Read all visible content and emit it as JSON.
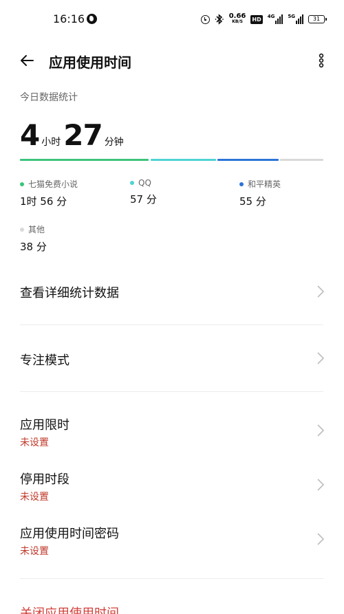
{
  "status_bar": {
    "time": "16:16",
    "speed_value": "0.66",
    "speed_unit": "KB/S",
    "hd_badge": "HD",
    "net1_label": "4G",
    "net2_label": "5G",
    "battery": "31"
  },
  "header": {
    "title": "应用使用时间"
  },
  "stats": {
    "section_label": "今日数据统计",
    "hours": "4",
    "hours_unit": "小时",
    "minutes": "27",
    "minutes_unit": "分钟",
    "bar_colors": [
      "#3cc47c",
      "#4fd3d4",
      "#2b74d8",
      "#d9d9d9"
    ],
    "apps": [
      {
        "name": "七猫免费小说",
        "time": "1时 56 分",
        "color": "#3cc47c"
      },
      {
        "name": "QQ",
        "time": "57 分",
        "color": "#4fd3d4"
      },
      {
        "name": "和平精英",
        "time": "55 分",
        "color": "#2b74d8"
      },
      {
        "name": "其他",
        "time": "38 分",
        "color": "#d9d9d9"
      }
    ]
  },
  "menu": {
    "detail_stats": "查看详细统计数据",
    "focus_mode": "专注模式",
    "app_limit": "应用限时",
    "app_limit_status": "未设置",
    "downtime": "停用时段",
    "downtime_status": "未设置",
    "passcode": "应用使用时间密码",
    "passcode_status": "未设置",
    "turn_off": "关闭应用使用时间"
  }
}
